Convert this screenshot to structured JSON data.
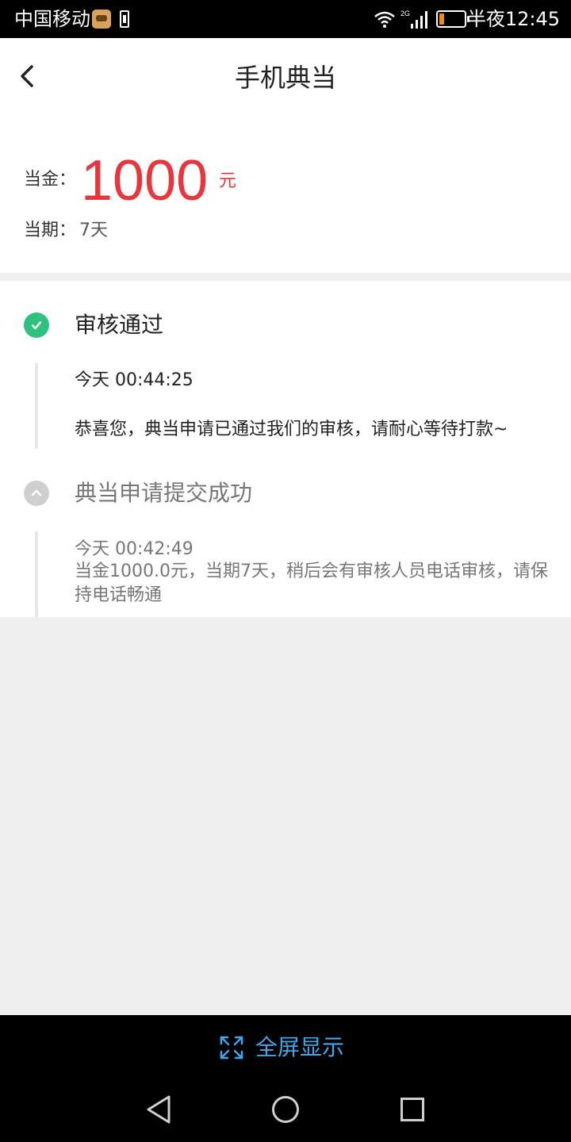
{
  "status_bar": {
    "carrier": "中国移动",
    "network": "2G",
    "time": "半夜12:45"
  },
  "header": {
    "title": "手机典当"
  },
  "summary": {
    "amount_label": "当金：",
    "amount_value": "1000",
    "amount_unit": "元",
    "period_label": "当期：",
    "period_value": "7天"
  },
  "timeline": [
    {
      "status": "审核通过",
      "time": "今天 00:44:25",
      "description": "恭喜您，典当申请已通过我们的审核，请耐心等待打款~",
      "active": true
    },
    {
      "status": "典当申请提交成功",
      "time": "今天 00:42:49",
      "description": "当金1000.0元，当期7天，稍后会有审核人员电话审核，请保持电话畅通",
      "active": false
    }
  ],
  "bottom_bar": {
    "fullscreen_label": "全屏显示"
  },
  "colors": {
    "accent_red": "#e8363c",
    "success_green": "#2fc17f",
    "link_blue": "#3ea7ee"
  }
}
